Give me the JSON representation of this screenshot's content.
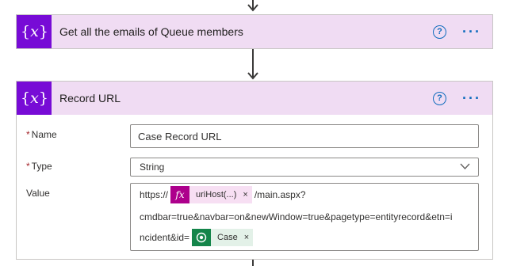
{
  "cards": [
    {
      "title": "Get all the emails of Queue members",
      "icon": "variable-icon",
      "help_icon": "help-icon",
      "more_icon": "more-options-icon"
    },
    {
      "title": "Record URL",
      "icon": "variable-icon",
      "help_icon": "help-icon",
      "more_icon": "more-options-icon",
      "fields": {
        "name": {
          "label": "Name",
          "required": "*",
          "value": "Case Record URL"
        },
        "type": {
          "label": "Type",
          "required": "*",
          "value": "String",
          "chevron": "chevron-down-icon"
        },
        "value": {
          "label": "Value",
          "line1_prefix": "https://",
          "token1": {
            "icon": "fx",
            "label": "uriHost(...)",
            "close": "×"
          },
          "line1_suffix": "/main.aspx?",
          "line2": "cmdbar=true&navbar=on&newWindow=true&pagetype=entityrecord&etn=i",
          "line3_prefix": "ncident&id=",
          "token2": {
            "icon": "dataverse-icon",
            "label": "Case",
            "close": "×"
          }
        }
      }
    }
  ],
  "icon_glyphs": {
    "variable": "{x}",
    "help": "?",
    "more": "···"
  },
  "colors": {
    "header_bg": "#f0dcf3",
    "variable_icon_bg": "#770bd6",
    "accent": "#0f6cbd",
    "required": "#a4262c",
    "fx_token": "#ad008c",
    "dataverse_token": "#14854a"
  }
}
